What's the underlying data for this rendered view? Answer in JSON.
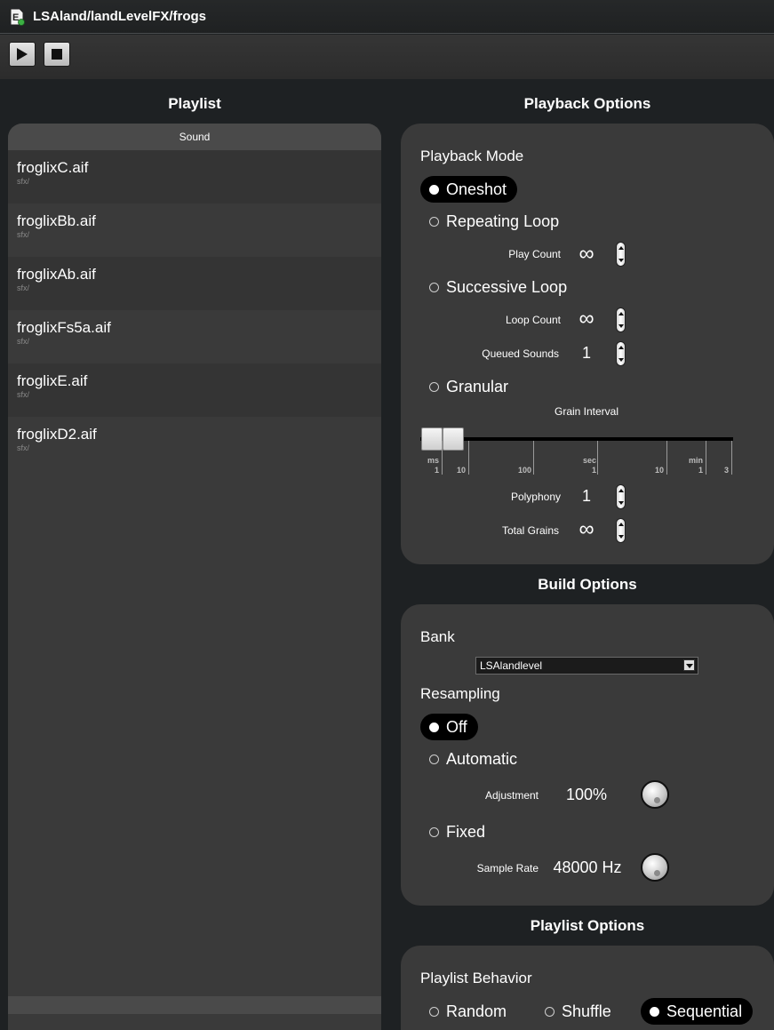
{
  "window": {
    "title": "LSAland/landLevelFX/frogs",
    "app_icon": "document-e-icon"
  },
  "toolbar": {
    "play_icon": "play-icon",
    "stop_icon": "stop-icon"
  },
  "headings": {
    "playlist": "Playlist",
    "playback_options": "Playback Options",
    "build_options": "Build Options",
    "playlist_options": "Playlist Options"
  },
  "playlist": {
    "column_header": "Sound",
    "items": [
      {
        "name": "froglixC.aif",
        "path": "sfx/"
      },
      {
        "name": "froglixBb.aif",
        "path": "sfx/"
      },
      {
        "name": "froglixAb.aif",
        "path": "sfx/"
      },
      {
        "name": "froglixFs5a.aif",
        "path": "sfx/"
      },
      {
        "name": "froglixE.aif",
        "path": "sfx/"
      },
      {
        "name": "froglixD2.aif",
        "path": "sfx/"
      }
    ]
  },
  "playback": {
    "mode_label": "Playback Mode",
    "selected_mode": "Oneshot",
    "modes": {
      "oneshot": "Oneshot",
      "repeating": "Repeating Loop",
      "successive": "Successive Loop",
      "granular": "Granular"
    },
    "play_count": {
      "label": "Play Count",
      "value": "∞"
    },
    "loop_count": {
      "label": "Loop Count",
      "value": "∞"
    },
    "queued_sounds": {
      "label": "Queued Sounds",
      "value": "1"
    },
    "grain_interval": {
      "label": "Grain Interval",
      "units": {
        "ms": "ms",
        "sec": "sec",
        "min": "min"
      },
      "ticks": [
        "1",
        "10",
        "100",
        "1",
        "10",
        "1",
        "3"
      ]
    },
    "polyphony": {
      "label": "Polyphony",
      "value": "1"
    },
    "total_grains": {
      "label": "Total Grains",
      "value": "∞"
    }
  },
  "build": {
    "bank_label": "Bank",
    "bank_value": "LSAlandlevel",
    "resampling_label": "Resampling",
    "selected_resampling": "Off",
    "resampling": {
      "off": "Off",
      "automatic": "Automatic",
      "fixed": "Fixed"
    },
    "adjustment": {
      "label": "Adjustment",
      "value": "100%"
    },
    "sample_rate": {
      "label": "Sample Rate",
      "value": "48000 Hz"
    }
  },
  "playlist_options": {
    "behavior_label": "Playlist Behavior",
    "selected_behavior": "Sequential",
    "behaviors": {
      "random": "Random",
      "shuffle": "Shuffle",
      "sequential": "Sequential"
    }
  },
  "colors": {
    "background": "#1e2123",
    "panel": "#3a3a3a",
    "selected_pill": "#000000",
    "text": "#ffffff"
  }
}
